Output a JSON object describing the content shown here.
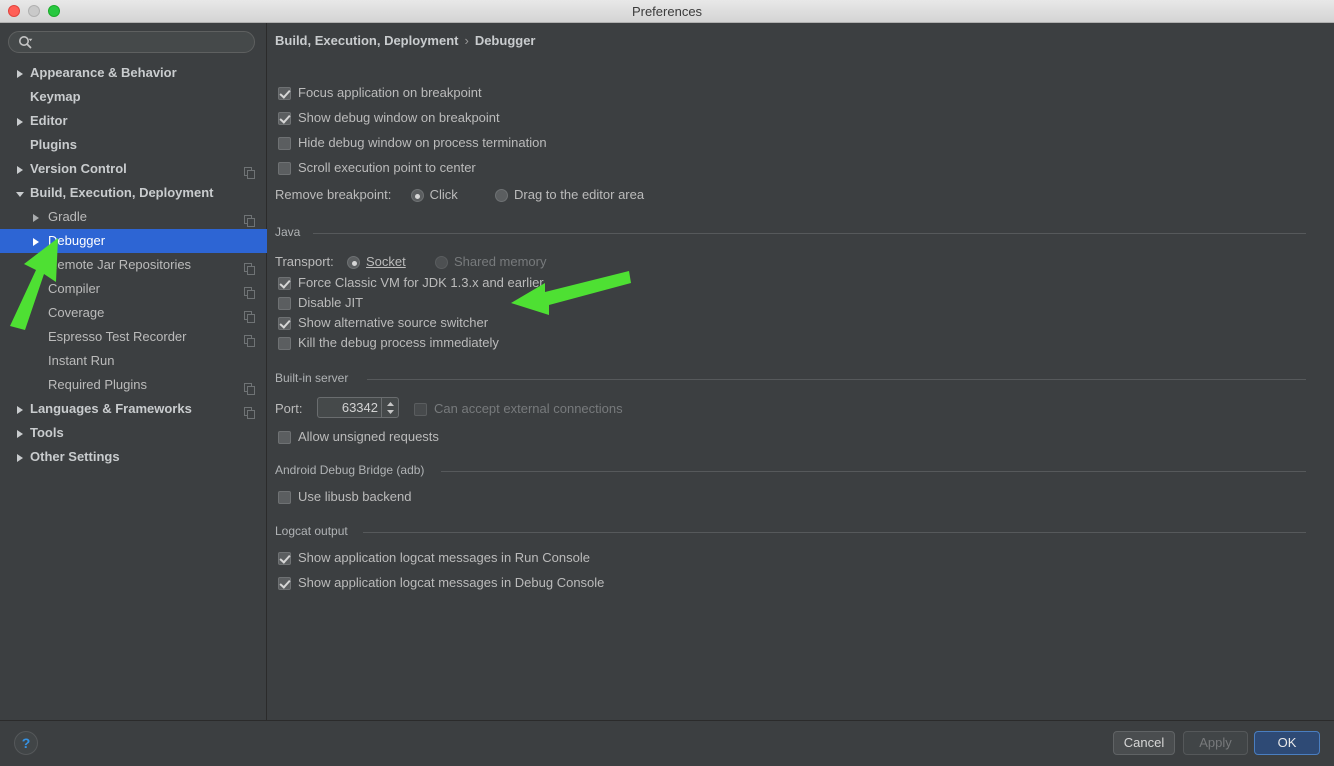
{
  "window": {
    "title": "Preferences",
    "traffic_lights": [
      "close-red",
      "minimize-grey",
      "zoom-green"
    ]
  },
  "sidebar": {
    "search": {
      "value": "",
      "placeholder": ""
    },
    "items": [
      {
        "label": "Appearance & Behavior",
        "indent": 0,
        "arrow": "right",
        "bold": true,
        "copy": false,
        "selected": false
      },
      {
        "label": "Keymap",
        "indent": 0,
        "arrow": "none",
        "bold": true,
        "copy": false,
        "selected": false
      },
      {
        "label": "Editor",
        "indent": 0,
        "arrow": "right",
        "bold": true,
        "copy": false,
        "selected": false
      },
      {
        "label": "Plugins",
        "indent": 0,
        "arrow": "none",
        "bold": true,
        "copy": false,
        "selected": false
      },
      {
        "label": "Version Control",
        "indent": 0,
        "arrow": "right",
        "bold": true,
        "copy": true,
        "selected": false
      },
      {
        "label": "Build, Execution, Deployment",
        "indent": 0,
        "arrow": "down",
        "bold": true,
        "copy": false,
        "selected": false
      },
      {
        "label": "Gradle",
        "indent": 1,
        "arrow": "right",
        "bold": false,
        "copy": true,
        "selected": false
      },
      {
        "label": "Debugger",
        "indent": 1,
        "arrow": "right",
        "bold": false,
        "copy": false,
        "selected": true
      },
      {
        "label": "Remote Jar Repositories",
        "indent": 1,
        "arrow": "none",
        "bold": false,
        "copy": true,
        "selected": false
      },
      {
        "label": "Compiler",
        "indent": 1,
        "arrow": "none",
        "bold": false,
        "copy": true,
        "selected": false
      },
      {
        "label": "Coverage",
        "indent": 1,
        "arrow": "none",
        "bold": false,
        "copy": true,
        "selected": false
      },
      {
        "label": "Espresso Test Recorder",
        "indent": 1,
        "arrow": "none",
        "bold": false,
        "copy": true,
        "selected": false
      },
      {
        "label": "Instant Run",
        "indent": 1,
        "arrow": "none",
        "bold": false,
        "copy": false,
        "selected": false
      },
      {
        "label": "Required Plugins",
        "indent": 1,
        "arrow": "none",
        "bold": false,
        "copy": true,
        "selected": false
      },
      {
        "label": "Languages & Frameworks",
        "indent": 0,
        "arrow": "right",
        "bold": true,
        "copy": true,
        "selected": false
      },
      {
        "label": "Tools",
        "indent": 0,
        "arrow": "right",
        "bold": true,
        "copy": false,
        "selected": false
      },
      {
        "label": "Other Settings",
        "indent": 0,
        "arrow": "right",
        "bold": true,
        "copy": false,
        "selected": false
      }
    ]
  },
  "panel": {
    "breadcrumb": {
      "parent": "Build, Execution, Deployment",
      "separator": "›",
      "current": "Debugger"
    },
    "top_options": [
      {
        "label": "Focus application on breakpoint",
        "checked": true,
        "disabled": false
      },
      {
        "label": "Show debug window on breakpoint",
        "checked": true,
        "disabled": false
      },
      {
        "label": "Hide debug window on process termination",
        "checked": false,
        "disabled": false
      },
      {
        "label": "Scroll execution point to center",
        "checked": false,
        "disabled": false
      }
    ],
    "remove_breakpoint": {
      "label": "Remove breakpoint:",
      "options": [
        {
          "label": "Click",
          "selected": true
        },
        {
          "label": "Drag to the editor area",
          "selected": false
        }
      ]
    },
    "java_section": {
      "title": "Java",
      "transport_label": "Transport:",
      "transport_options": [
        {
          "label": "Socket",
          "selected": true,
          "disabled": false,
          "mnemonic": "S"
        },
        {
          "label": "Shared memory",
          "selected": false,
          "disabled": true,
          "mnemonic": "m"
        }
      ],
      "options": [
        {
          "label": "Force Classic VM for JDK 1.3.x and earlier",
          "checked": true,
          "disabled": false
        },
        {
          "label": "Disable JIT",
          "checked": false,
          "disabled": false
        },
        {
          "label": "Show alternative source switcher",
          "checked": true,
          "disabled": false
        },
        {
          "label": "Kill the debug process immediately",
          "checked": false,
          "disabled": false
        }
      ]
    },
    "builtin_server": {
      "title": "Built-in server",
      "port_label": "Port:",
      "port_value": "63342",
      "external_connections": {
        "label": "Can accept external connections",
        "checked": false,
        "disabled": true
      },
      "allow_unsigned": {
        "label": "Allow unsigned requests",
        "checked": false,
        "disabled": false
      }
    },
    "adb_section": {
      "title": "Android Debug Bridge (adb)",
      "options": [
        {
          "label": "Use libusb backend",
          "checked": false,
          "disabled": false
        }
      ]
    },
    "logcat_section": {
      "title": "Logcat output",
      "options": [
        {
          "label": "Show application logcat messages in Run Console",
          "checked": true,
          "disabled": false
        },
        {
          "label": "Show application logcat messages in Debug Console",
          "checked": true,
          "disabled": false
        }
      ]
    }
  },
  "footer": {
    "help_glyph": "?",
    "cancel_label": "Cancel",
    "apply_label": "Apply",
    "ok_label": "OK"
  },
  "annotations": {
    "arrow_color": "#4ee033",
    "arrows": [
      {
        "name": "arrow-pointing-to-debugger",
        "target": "Debugger"
      },
      {
        "name": "arrow-pointing-to-show-alternative-source-switcher",
        "target": "Show alternative source switcher"
      }
    ]
  },
  "colors": {
    "window_bg": "#3c3f41",
    "selection_blue": "#2d65d4",
    "ok_button_blue": "#2e4a75",
    "text": "#bbbbbb",
    "annotation_green": "#4ee033"
  }
}
